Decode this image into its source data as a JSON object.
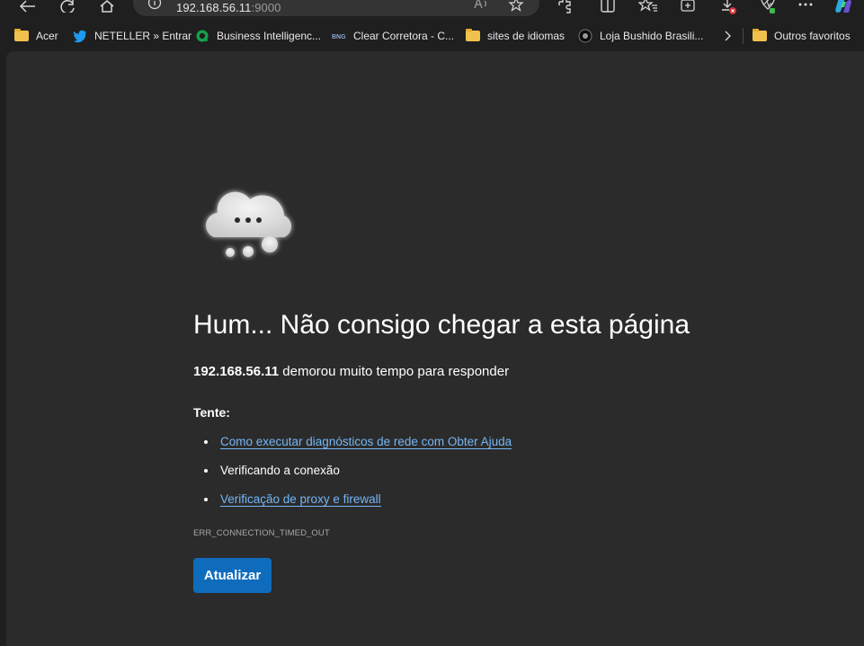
{
  "address_bar": {
    "host": "192.168.56.11",
    "port": ":9000"
  },
  "bookmarks": [
    {
      "label": "Acer",
      "icon": "folder-icon"
    },
    {
      "label": "NETELLER » Entrar",
      "icon": "twitter-bird-icon"
    },
    {
      "label": "Business Intelligenc...",
      "icon": "qlik-icon"
    },
    {
      "label": "Clear Corretora - C...",
      "icon": "bng-icon"
    },
    {
      "label": "sites de idiomas",
      "icon": "folder-icon"
    },
    {
      "label": "Loja Bushido Brasili...",
      "icon": "bushido-icon"
    }
  ],
  "other_favorites": {
    "label": "Outros favoritos",
    "icon": "folder-icon"
  },
  "error_page": {
    "title": "Hum... Não consigo chegar a esta página",
    "host": "192.168.56.11",
    "message_rest": " demorou muito tempo para responder",
    "try_label": "Tente:",
    "suggestions": [
      {
        "text": "Como executar diagnósticos de rede com Obter Ajuda",
        "link": true
      },
      {
        "text": "Verificando a conexão",
        "link": false
      },
      {
        "text": "Verificação de proxy e firewall",
        "link": true
      }
    ],
    "error_code": "ERR_CONNECTION_TIMED_OUT",
    "refresh_button": "Atualizar"
  },
  "colors": {
    "page_background": "#2b2b2b",
    "chrome_background": "#1f1f1f",
    "link": "#75b6f5",
    "primary_button": "#0f6cbd"
  }
}
